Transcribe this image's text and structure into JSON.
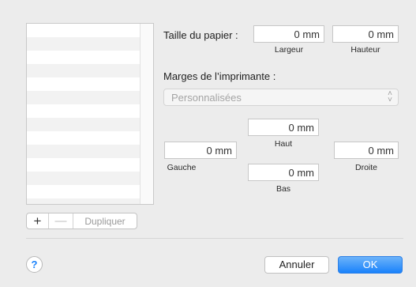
{
  "list": {
    "rows": 14
  },
  "list_controls": {
    "add_icon": "plus-icon",
    "add": "+",
    "remove_icon": "minus-icon",
    "remove": "—",
    "duplicate_label": "Dupliquer"
  },
  "paper_size": {
    "label": "Taille du papier :",
    "width_value": "0 mm",
    "height_value": "0 mm",
    "width_caption": "Largeur",
    "height_caption": "Hauteur"
  },
  "margins": {
    "label": "Marges de l’imprimante :",
    "popup_value": "Personnalisées",
    "popup_icon": "updown-chevron-icon",
    "chevron_up": "˄",
    "chevron_down": "˅",
    "top_value": "0 mm",
    "left_value": "0 mm",
    "right_value": "0 mm",
    "bottom_value": "0 mm",
    "top_caption": "Haut",
    "left_caption": "Gauche",
    "right_caption": "Droite",
    "bottom_caption": "Bas"
  },
  "footer": {
    "help_icon": "help-icon",
    "help": "?",
    "cancel_label": "Annuler",
    "ok_label": "OK"
  },
  "colors": {
    "accent": "#1a82fb",
    "background": "#ececec"
  }
}
